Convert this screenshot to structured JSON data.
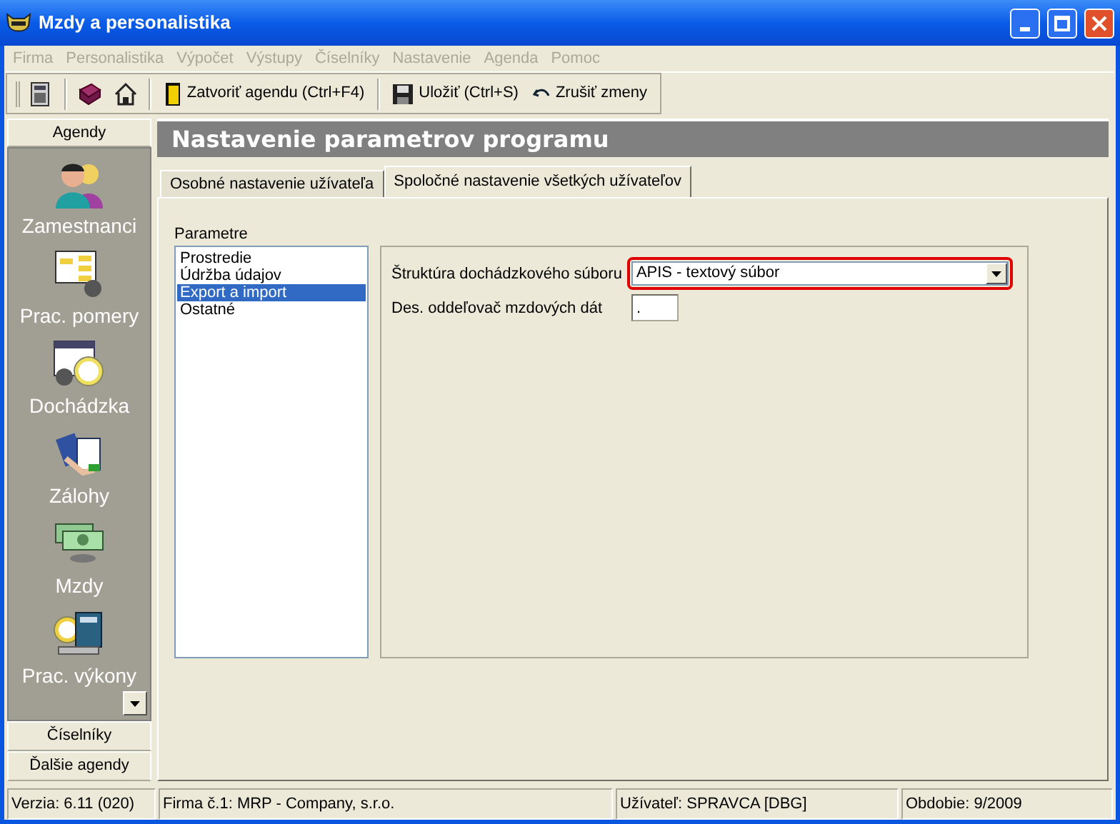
{
  "window": {
    "title": "Mzdy a personalistika"
  },
  "menu": [
    {
      "label": "Firma",
      "disabled": true
    },
    {
      "label": "Personalistika",
      "disabled": true
    },
    {
      "label": "Výpočet",
      "disabled": true
    },
    {
      "label": "Výstupy",
      "disabled": true
    },
    {
      "label": "Číselníky",
      "disabled": true
    },
    {
      "label": "Nastavenie",
      "disabled": true
    },
    {
      "label": "Agenda",
      "disabled": true
    },
    {
      "label": "Pomoc",
      "disabled": true
    }
  ],
  "toolbar": [
    {
      "label": "Zatvoriť agendu (Ctrl+F4)"
    },
    {
      "label": "Uložiť (Ctrl+S)"
    },
    {
      "label": "Zrušiť zmeny"
    }
  ],
  "sidebar": {
    "header": "Agendy",
    "items": [
      {
        "label": "Zamestnanci"
      },
      {
        "label": "Prac. pomery"
      },
      {
        "label": "Dochádzka"
      },
      {
        "label": "Zálohy"
      },
      {
        "label": "Mzdy"
      },
      {
        "label": "Prac. výkony"
      }
    ],
    "footer": [
      "Číselníky",
      "Ďalšie agendy"
    ]
  },
  "header": "Nastavenie parametrov programu",
  "tabs": [
    {
      "label": "Osobné nastavenie užívateľa",
      "selected": false
    },
    {
      "label": "Spoločné nastavenie všetkých užívateľov",
      "selected": true
    }
  ],
  "parameters": {
    "label": "Parametre",
    "items": [
      {
        "label": "Prostredie",
        "selected": false
      },
      {
        "label": "Údržba údajov",
        "selected": false
      },
      {
        "label": "Export a import",
        "selected": true
      },
      {
        "label": "Ostatné",
        "selected": false
      }
    ]
  },
  "fields": [
    {
      "kind": "select",
      "label": "Štruktúra dochádzkového súboru",
      "value": "APIS - textový súbor",
      "highlighted": true
    },
    {
      "kind": "text",
      "label": "Des. oddeľovač mzdových dát",
      "value": ".",
      "highlighted": false
    }
  ],
  "status_bar": [
    "Verzia: 6.11 (020)",
    "Firma č.1: MRP -  Company, s.r.o.",
    "Užívateľ: SPRAVCA [DBG]",
    "Obdobie: 9/2009"
  ]
}
